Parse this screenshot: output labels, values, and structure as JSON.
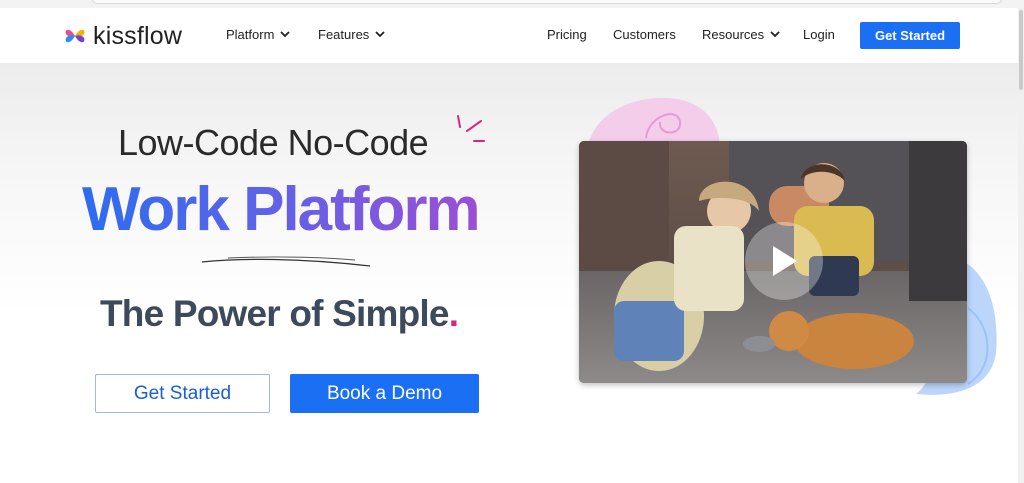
{
  "brand": {
    "name": "kissflow",
    "colors": {
      "primary": "#1a6ff2",
      "text": "#222222",
      "accent_pink": "#d6287a",
      "gradient_start": "#2d6cf0",
      "gradient_end": "#9b4fd4"
    }
  },
  "nav": {
    "items": [
      {
        "label": "Platform",
        "has_dropdown": true
      },
      {
        "label": "Features",
        "has_dropdown": true
      },
      {
        "label": "Pricing",
        "has_dropdown": false
      },
      {
        "label": "Customers",
        "has_dropdown": false
      },
      {
        "label": "Resources",
        "has_dropdown": true
      },
      {
        "label": "Login",
        "has_dropdown": false
      }
    ],
    "cta_label": "Get Started"
  },
  "hero": {
    "line1": "Low-Code No-Code",
    "line2": "Work Platform",
    "tagline": "The Power of Simple",
    "tagline_end": ".",
    "buttons": {
      "primary_outline": "Get Started",
      "primary_solid": "Book a Demo"
    }
  },
  "video": {
    "icon": "play-icon"
  }
}
